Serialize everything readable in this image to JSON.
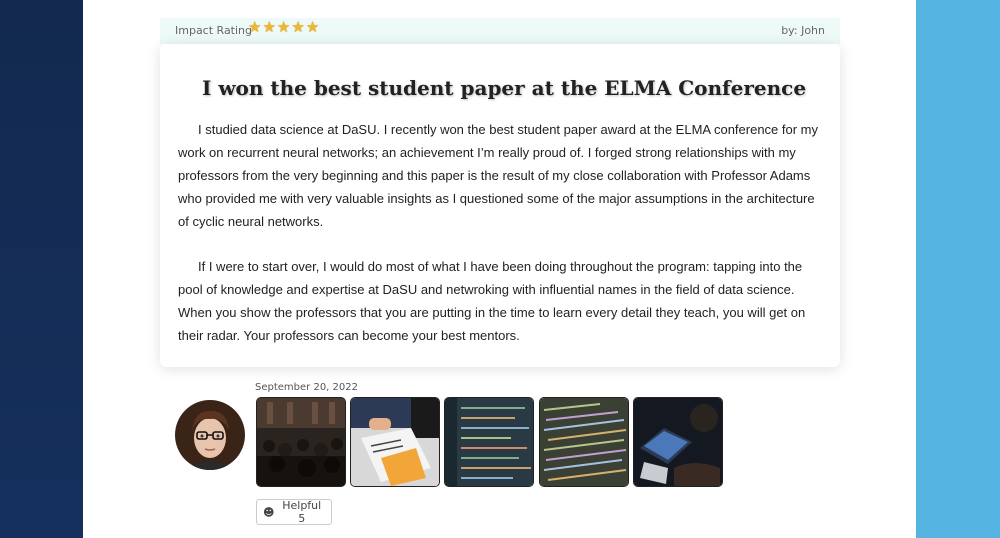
{
  "review": {
    "rating_label": "Impact Rating",
    "rating": 5,
    "rating_max": 5,
    "author_label": "by:  John",
    "title": "I won the best student paper at the ELMA Conference",
    "paragraphs": [
      "I studied data science at DaSU. I recently won the best student paper award at the ELMA conference for my work on recurrent neural networks; an achievement I’m really proud of. I forged strong relationships with my professors from the very beginning and this paper is the result of my close collaboration with Professor Adams who provided me with very valuable insights as I questioned some of the major assumptions in the architecture of cyclic neural networks.",
      "If I were to start over, I would do most of what I have been doing throughout the program: tapping into the pool of knowledge and expertise at DaSU and netwroking with influential names in the field of data science. When you show the professors that you are putting in the time to learn every detail they teach, you will get on their radar. Your professors can become your best mentors."
    ],
    "date": "September 20, 2022",
    "photos": [
      "lecture-hall-photo",
      "paperwork-photo",
      "data-visualization-photo",
      "code-screen-photo",
      "laptop-work-photo"
    ],
    "helpful_label": "Helpful 5"
  },
  "colors": {
    "left_band": "#13294f",
    "right_band": "#56b4e3",
    "star": "#f0b62c",
    "top_bar": "#eefaf8"
  }
}
